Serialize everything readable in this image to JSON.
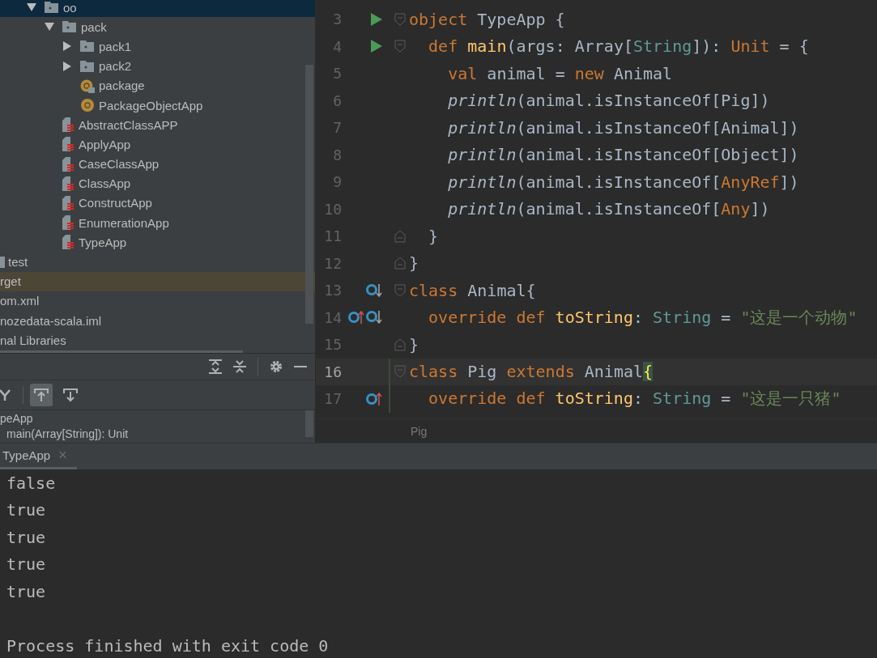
{
  "project_tree": {
    "items": [
      {
        "label": "oo",
        "kind": "folder",
        "expanded": true,
        "selected": true,
        "children": [
          {
            "label": "pack",
            "kind": "folder",
            "expanded": true,
            "selected": false,
            "children": [
              {
                "label": "pack1",
                "kind": "folder",
                "expanded": false,
                "selected": false
              },
              {
                "label": "pack2",
                "kind": "folder",
                "expanded": false,
                "selected": false
              },
              {
                "label": "package",
                "kind": "package-object",
                "selected": false
              },
              {
                "label": "PackageObjectApp",
                "kind": "object",
                "selected": false
              }
            ]
          },
          {
            "label": "AbstractClassAPP",
            "kind": "scala-file",
            "selected": false
          },
          {
            "label": "ApplyApp",
            "kind": "scala-file",
            "selected": false
          },
          {
            "label": "CaseClassApp",
            "kind": "scala-file",
            "selected": false
          },
          {
            "label": "ClassApp",
            "kind": "scala-file",
            "selected": false
          },
          {
            "label": "ConstructApp",
            "kind": "scala-file",
            "selected": false
          },
          {
            "label": "EnumerationApp",
            "kind": "scala-file",
            "selected": false
          },
          {
            "label": "TypeApp",
            "kind": "scala-file",
            "selected": false
          }
        ]
      }
    ],
    "trailing_items": [
      {
        "label": "test",
        "kind": "folder",
        "highlighted": false
      },
      {
        "label": "rget",
        "kind": "plain",
        "highlighted": true
      },
      {
        "label": "om.xml",
        "kind": "plain",
        "highlighted": false
      },
      {
        "label": "nozedata-scala.iml",
        "kind": "plain",
        "highlighted": false
      },
      {
        "label": "nal Libraries",
        "kind": "plain",
        "highlighted": false
      }
    ]
  },
  "structure_panel": {
    "buttons": [
      {
        "kind": "branch",
        "pressed": false
      },
      {
        "kind": "up",
        "pressed": true
      },
      {
        "kind": "down",
        "pressed": false
      }
    ],
    "items": [
      {
        "label": "peApp"
      },
      {
        "label": "main(Array[String]): Unit"
      }
    ]
  },
  "editor": {
    "lines": [
      {
        "number": "3",
        "gutter": [
          {
            "kind": "run"
          }
        ],
        "fold": {
          "kind": "start"
        },
        "current": false,
        "changed": false,
        "tokens": [
          {
            "text": "object",
            "kind": "keyword"
          },
          {
            "text": " TypeApp {",
            "kind": "plain"
          }
        ]
      },
      {
        "number": "4",
        "gutter": [
          {
            "kind": "run"
          }
        ],
        "fold": {
          "kind": "start"
        },
        "current": false,
        "changed": false,
        "tokens": [
          {
            "text": "  def",
            "kind": "keyword"
          },
          {
            "text": " main",
            "kind": "function"
          },
          {
            "text": "(args: Array[",
            "kind": "plain"
          },
          {
            "text": "String",
            "kind": "type"
          },
          {
            "text": "]): ",
            "kind": "plain"
          },
          {
            "text": "Unit",
            "kind": "keyword"
          },
          {
            "text": " = {",
            "kind": "plain"
          }
        ]
      },
      {
        "number": "5",
        "current": false,
        "changed": false,
        "tokens": [
          {
            "text": "    val",
            "kind": "keyword"
          },
          {
            "text": " animal = ",
            "kind": "plain"
          },
          {
            "text": "new",
            "kind": "keyword"
          },
          {
            "text": " Animal",
            "kind": "plain"
          }
        ]
      },
      {
        "number": "6",
        "current": false,
        "changed": false,
        "tokens": [
          {
            "text": "    println",
            "kind": "italic"
          },
          {
            "text": "(animal.isInstanceOf[Pig])",
            "kind": "plain"
          }
        ]
      },
      {
        "number": "7",
        "current": false,
        "changed": false,
        "tokens": [
          {
            "text": "    println",
            "kind": "italic"
          },
          {
            "text": "(animal.isInstanceOf[Animal])",
            "kind": "plain"
          }
        ]
      },
      {
        "number": "8",
        "current": false,
        "changed": false,
        "tokens": [
          {
            "text": "    println",
            "kind": "italic"
          },
          {
            "text": "(animal.isInstanceOf[Object])",
            "kind": "plain"
          }
        ]
      },
      {
        "number": "9",
        "current": false,
        "changed": false,
        "tokens": [
          {
            "text": "    println",
            "kind": "italic"
          },
          {
            "text": "(animal.isInstanceOf[",
            "kind": "plain"
          },
          {
            "text": "AnyRef",
            "kind": "keyword"
          },
          {
            "text": "])",
            "kind": "plain"
          }
        ]
      },
      {
        "number": "10",
        "current": false,
        "changed": false,
        "tokens": [
          {
            "text": "    println",
            "kind": "italic"
          },
          {
            "text": "(animal.isInstanceOf[",
            "kind": "plain"
          },
          {
            "text": "Any",
            "kind": "keyword"
          },
          {
            "text": "])",
            "kind": "plain"
          }
        ]
      },
      {
        "number": "11",
        "fold": {
          "kind": "end"
        },
        "current": false,
        "changed": false,
        "tokens": [
          {
            "text": "  }",
            "kind": "plain"
          }
        ]
      },
      {
        "number": "12",
        "fold": {
          "kind": "end"
        },
        "current": false,
        "changed": false,
        "tokens": [
          {
            "text": "}",
            "kind": "plain"
          }
        ]
      },
      {
        "number": "13",
        "gutter": [
          {
            "kind": "implemented"
          }
        ],
        "fold": {
          "kind": "start"
        },
        "current": false,
        "changed": false,
        "tokens": [
          {
            "text": "class",
            "kind": "keyword"
          },
          {
            "text": " Animal{",
            "kind": "plain"
          }
        ]
      },
      {
        "number": "14",
        "gutter": [
          {
            "kind": "overrides"
          },
          {
            "kind": "implemented"
          }
        ],
        "current": false,
        "changed": false,
        "tokens": [
          {
            "text": "  override def",
            "kind": "keyword"
          },
          {
            "text": " toString",
            "kind": "function"
          },
          {
            "text": ": ",
            "kind": "plain"
          },
          {
            "text": "String",
            "kind": "type"
          },
          {
            "text": " = ",
            "kind": "plain"
          },
          {
            "text": "\"这是一个动物\"",
            "kind": "string"
          }
        ]
      },
      {
        "number": "15",
        "fold": {
          "kind": "end"
        },
        "current": false,
        "changed": false,
        "tokens": [
          {
            "text": "}",
            "kind": "plain"
          }
        ]
      },
      {
        "number": "16",
        "fold": {
          "kind": "start"
        },
        "current": true,
        "changed": true,
        "tokens": [
          {
            "text": "class",
            "kind": "keyword"
          },
          {
            "text": " Pig ",
            "kind": "plain"
          },
          {
            "text": "extends",
            "kind": "keyword"
          },
          {
            "text": " Animal",
            "kind": "plain"
          },
          {
            "text": "{",
            "kind": "brace-match"
          }
        ]
      },
      {
        "number": "17",
        "gutter": [
          {
            "kind": "overrides"
          }
        ],
        "current": false,
        "changed": true,
        "tokens": [
          {
            "text": "  override def",
            "kind": "keyword"
          },
          {
            "text": " toString",
            "kind": "function"
          },
          {
            "text": ": ",
            "kind": "plain"
          },
          {
            "text": "String",
            "kind": "type"
          },
          {
            "text": " = ",
            "kind": "plain"
          },
          {
            "text": "\"这是一只猪\"",
            "kind": "string"
          }
        ]
      }
    ],
    "breadcrumb": "Pig"
  },
  "run_panel": {
    "tab": {
      "label": "TypeApp",
      "selected": true,
      "close": "×"
    },
    "output": [
      "false",
      "true",
      "true",
      "true",
      "true"
    ],
    "exit_message": "Process finished with exit code 0"
  }
}
